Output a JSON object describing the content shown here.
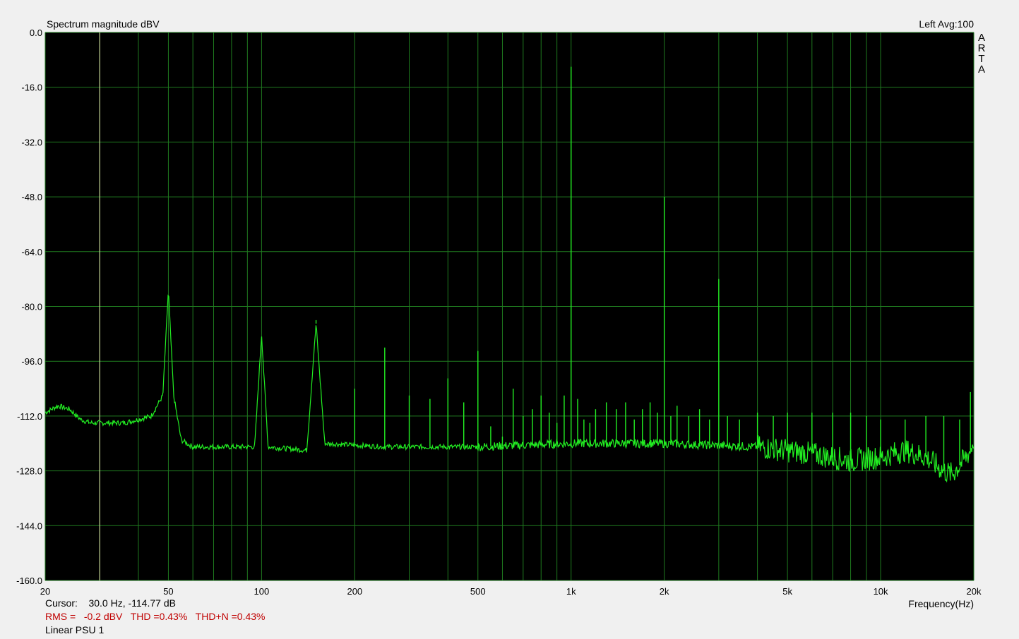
{
  "chart_data": {
    "type": "line",
    "title": "Spectrum magnitude dBV",
    "channel_info": "Left  Avg:100",
    "xlabel": "Frequency(Hz)",
    "ylabel": "",
    "x_scale": "log",
    "xlim": [
      20,
      20000
    ],
    "ylim": [
      -160,
      0
    ],
    "y_ticks": [
      "0.0",
      "-16.0",
      "-32.0",
      "-48.0",
      "-64.0",
      "-80.0",
      "-96.0",
      "-112.0",
      "-128.0",
      "-144.0",
      "-160.0"
    ],
    "x_ticks": [
      {
        "value": 20,
        "label": "20"
      },
      {
        "value": 50,
        "label": "50"
      },
      {
        "value": 100,
        "label": "100"
      },
      {
        "value": 200,
        "label": "200"
      },
      {
        "value": 500,
        "label": "500"
      },
      {
        "value": 1000,
        "label": "1k"
      },
      {
        "value": 2000,
        "label": "2k"
      },
      {
        "value": 5000,
        "label": "5k"
      },
      {
        "value": 10000,
        "label": "10k"
      },
      {
        "value": 20000,
        "label": "20k"
      }
    ],
    "grid": true,
    "cursor_x": 30,
    "series": [
      {
        "name": "Linear PSU 1",
        "color": "#22ee22",
        "baseline": [
          [
            20,
            -111
          ],
          [
            22,
            -109
          ],
          [
            24,
            -110
          ],
          [
            26,
            -113
          ],
          [
            28,
            -114
          ],
          [
            32,
            -114
          ],
          [
            36,
            -114
          ],
          [
            40,
            -113
          ],
          [
            44,
            -112
          ],
          [
            48,
            -106
          ],
          [
            50,
            -75
          ],
          [
            52,
            -106
          ],
          [
            55,
            -119
          ],
          [
            60,
            -121
          ],
          [
            70,
            -121
          ],
          [
            90,
            -121
          ],
          [
            95,
            -121
          ],
          [
            100,
            -88
          ],
          [
            105,
            -121
          ],
          [
            140,
            -122
          ],
          [
            150,
            -85
          ],
          [
            160,
            -120
          ],
          [
            250,
            -121
          ],
          [
            500,
            -121
          ],
          [
            1000,
            -120
          ],
          [
            2000,
            -120
          ],
          [
            4000,
            -121
          ],
          [
            6000,
            -123
          ],
          [
            8000,
            -125
          ],
          [
            10000,
            -124
          ],
          [
            12000,
            -122
          ],
          [
            14000,
            -124
          ],
          [
            16000,
            -128
          ],
          [
            17000,
            -129
          ],
          [
            18500,
            -125
          ],
          [
            19500,
            -122
          ],
          [
            20000,
            -119
          ]
        ],
        "spikes": [
          [
            100,
            -88
          ],
          [
            150,
            -84
          ],
          [
            200,
            -104
          ],
          [
            250,
            -92
          ],
          [
            300,
            -106
          ],
          [
            350,
            -107
          ],
          [
            400,
            -101
          ],
          [
            450,
            -108
          ],
          [
            500,
            -93
          ],
          [
            550,
            -115
          ],
          [
            600,
            -118
          ],
          [
            650,
            -104
          ],
          [
            700,
            -112
          ],
          [
            750,
            -110
          ],
          [
            800,
            -106
          ],
          [
            850,
            -111
          ],
          [
            900,
            -114
          ],
          [
            950,
            -106
          ],
          [
            1000,
            -10
          ],
          [
            1050,
            -107
          ],
          [
            1100,
            -113
          ],
          [
            1150,
            -114
          ],
          [
            1200,
            -110
          ],
          [
            1300,
            -108
          ],
          [
            1400,
            -110
          ],
          [
            1500,
            -108
          ],
          [
            1600,
            -113
          ],
          [
            1700,
            -110
          ],
          [
            1800,
            -108
          ],
          [
            1900,
            -111
          ],
          [
            2000,
            -48
          ],
          [
            2100,
            -112
          ],
          [
            2200,
            -109
          ],
          [
            2400,
            -112
          ],
          [
            2600,
            -110
          ],
          [
            2800,
            -113
          ],
          [
            3000,
            -72
          ],
          [
            3200,
            -112
          ],
          [
            3500,
            -113
          ],
          [
            4000,
            -111
          ],
          [
            4500,
            -112
          ],
          [
            5000,
            -111
          ],
          [
            6000,
            -111
          ],
          [
            7000,
            -111
          ],
          [
            8000,
            -111
          ],
          [
            9000,
            -112
          ],
          [
            10000,
            -113
          ],
          [
            12000,
            -113
          ],
          [
            14000,
            -112
          ],
          [
            16000,
            -112
          ],
          [
            18000,
            -113
          ],
          [
            19500,
            -105
          ]
        ]
      }
    ]
  },
  "footer": {
    "cursor_text": "Cursor:    30.0 Hz, -114.77 dB",
    "metrics_text": "RMS =   -0.2 dBV   THD =0.43%   THD+N =0.43%",
    "legend_text": "Linear PSU 1"
  },
  "brand": {
    "letters": [
      "A",
      "R",
      "T",
      "A"
    ]
  },
  "colors": {
    "plot_bg": "#000000",
    "grid": "#1f7a1f",
    "trace": "#22ee22",
    "cursor": "#e8e8b0",
    "metrics_text": "#c00000"
  }
}
